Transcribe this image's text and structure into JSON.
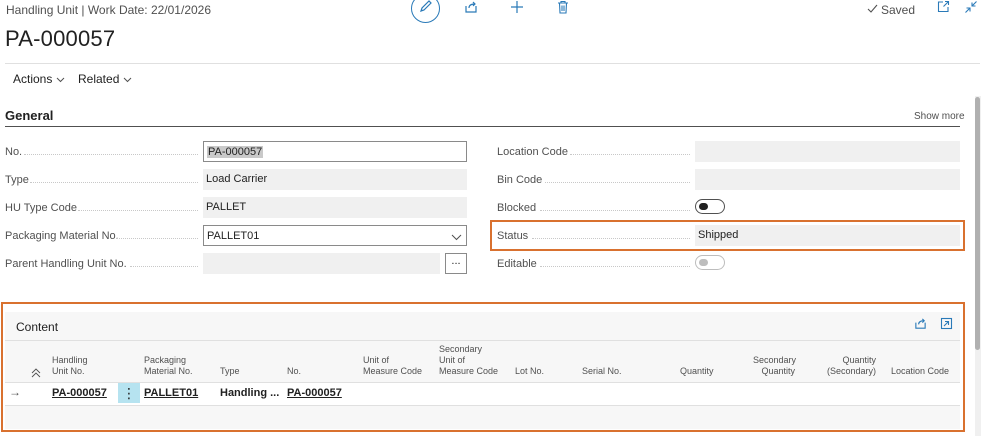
{
  "header": {
    "breadcrumb": "Handling Unit | Work Date: 22/01/2026",
    "title": "PA-000057",
    "saved_label": "Saved"
  },
  "toolbar": {
    "icons": [
      "edit-icon",
      "share-icon",
      "add-icon",
      "delete-icon",
      "open-new-window-icon",
      "collapse-icon"
    ]
  },
  "actionbar": {
    "actions_label": "Actions",
    "related_label": "Related"
  },
  "general": {
    "title": "General",
    "show_more": "Show more",
    "fields": {
      "no_label": "No.",
      "no_value": "PA-000057",
      "type_label": "Type",
      "type_value": "Load Carrier",
      "hu_type_label": "HU Type Code",
      "hu_type_value": "PALLET",
      "packaging_label": "Packaging Material No.",
      "packaging_value": "PALLET01",
      "parent_label": "Parent Handling Unit No.",
      "parent_value": "",
      "parent_lookup": "...",
      "location_label": "Location Code",
      "location_value": "",
      "bin_label": "Bin Code",
      "bin_value": "",
      "blocked_label": "Blocked",
      "blocked_value": false,
      "status_label": "Status",
      "status_value": "Shipped",
      "editable_label": "Editable",
      "editable_value": false
    }
  },
  "content": {
    "title": "Content",
    "columns": {
      "hu_no": [
        "Handling",
        "Unit No."
      ],
      "packaging": [
        "Packaging",
        "Material No."
      ],
      "type": [
        "Type"
      ],
      "no": [
        "No."
      ],
      "uom": [
        "Unit of",
        "Measure Code"
      ],
      "sec_uom": [
        "Secondary",
        "Unit of",
        "Measure Code"
      ],
      "lot": [
        "Lot No."
      ],
      "serial": [
        "Serial No."
      ],
      "quantity": [
        "Quantity"
      ],
      "sec_qty": [
        "Secondary",
        "Quantity"
      ],
      "qty_sec": [
        "Quantity",
        "(Secondary)"
      ],
      "location": [
        "Location Code"
      ]
    },
    "rows": [
      {
        "arrow": "→",
        "hu_no": "PA-000057",
        "menu": "⋮",
        "packaging": "PALLET01",
        "type": "Handling ...",
        "no": "PA-000057"
      }
    ]
  },
  "colors": {
    "highlight": "#d9712f",
    "accent": "#2a7ab8",
    "row_menu_bg": "#b6e3f0"
  }
}
